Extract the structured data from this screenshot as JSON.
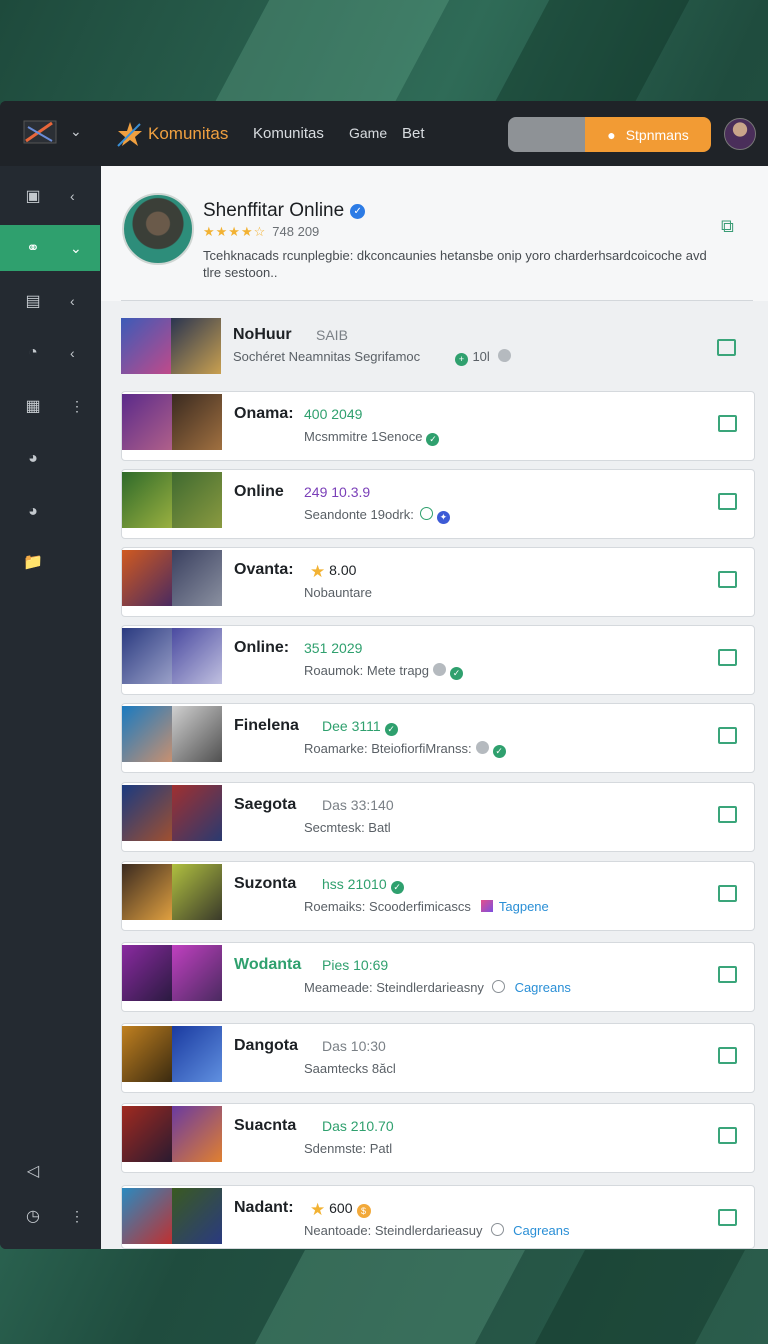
{
  "topbar": {
    "brand": "Komunitas",
    "nav": [
      "Komunitas",
      "Game",
      "Bet"
    ],
    "cta_label": "Stpnmans"
  },
  "profile": {
    "name": "Shenffitar Online",
    "rating_count": "748 209",
    "stars": "★★★★☆",
    "description": "Tcehknacads rcunplegbie: dkconcaunies hetansbe onip yoro charderhsardcoicoche avd tlre sestoon.."
  },
  "rows": [
    {
      "title": "NoHuur",
      "meta": "SAIB",
      "sub": "Sochéret   Neamnitas   Segrifamoc",
      "extra": "10l"
    },
    {
      "title": "Onama:",
      "meta": "400  2049",
      "sub": "Mcsmmitre 1Senoce"
    },
    {
      "title": "Online",
      "meta": "249  10.3.9",
      "sub": "Seandonte 19odrk:"
    },
    {
      "title": "Ovanta:",
      "meta": "8.00",
      "sub": "Nobauntare"
    },
    {
      "title": "Online:",
      "meta": "351  2029",
      "sub": "Roaumok:  Mete trapg"
    },
    {
      "title": "Finelena",
      "meta": "Dee 3111",
      "sub": "Roamarke:  BteiofiorfiMranss:"
    },
    {
      "title": "Saegota",
      "meta": "Das 33:140",
      "sub": "Secmtesk:  Batl"
    },
    {
      "title": "Suzonta",
      "meta": "hss 21010",
      "sub": "Roemaiks:  Scooderfimicascs",
      "tag": "Tagpene"
    },
    {
      "title": "Wodanta",
      "meta": "Pies 10:69",
      "sub": "Meameade:  Steindlerdarieasny",
      "tag": "Cagreans"
    },
    {
      "title": "Dangota",
      "meta": "Das 10:30",
      "sub": "Saamtecks  8ăcl"
    },
    {
      "title": "Suacnta",
      "meta": "Das 210.70",
      "sub": "Sdenmste:  Patl"
    },
    {
      "title": "Nadant:",
      "meta": "600",
      "sub": "Neantoade:  Steindlerdarieasuy",
      "tag": "Cagreans"
    }
  ],
  "colors": {
    "accent": "#2fa06e",
    "cta": "#f29b34",
    "sidebar": "#242a31"
  }
}
